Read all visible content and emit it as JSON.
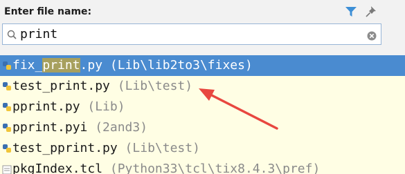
{
  "header": {
    "label": "Enter file name:",
    "filter_icon": "filter-icon",
    "pin_icon": "pin-icon"
  },
  "search": {
    "value": "print",
    "icon": "search-icon",
    "clear_icon": "clear-icon"
  },
  "results": [
    {
      "pre": "fix_",
      "match": "print",
      "post": ".py",
      "location": " (Lib\\lib2to3\\fixes)",
      "selected": true,
      "icon": "python-file-icon"
    },
    {
      "pre": "test_print.py",
      "match": "",
      "post": "",
      "location": " (Lib\\test)",
      "selected": false,
      "icon": "python-file-icon"
    },
    {
      "pre": "pprint.py",
      "match": "",
      "post": "",
      "location": " (Lib)",
      "selected": false,
      "icon": "python-file-icon"
    },
    {
      "pre": "pprint.pyi",
      "match": "",
      "post": "",
      "location": " (2and3)",
      "selected": false,
      "icon": "python-file-icon"
    },
    {
      "pre": "test_pprint.py",
      "match": "",
      "post": "",
      "location": " (Lib\\test)",
      "selected": false,
      "icon": "python-file-icon"
    },
    {
      "pre": "pkgIndex.tcl",
      "match": "",
      "post": "",
      "location": " (Python33\\tcl\\tix8.4.3\\pref)",
      "selected": false,
      "icon": "tcl-file-icon"
    }
  ],
  "annotation": {
    "color": "#e8473f"
  },
  "colors": {
    "selection": "#4a8bd0",
    "list_background": "#fffee4",
    "filter_icon": "#3d8fd6"
  }
}
